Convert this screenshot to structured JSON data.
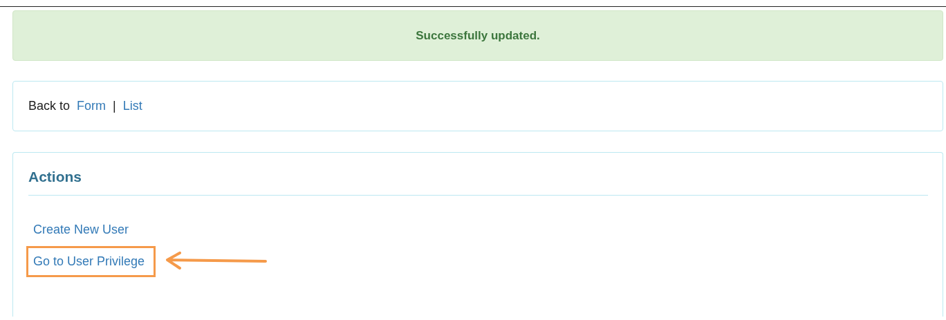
{
  "alert": {
    "message": "Successfully updated."
  },
  "back_nav": {
    "label": "Back to",
    "links": [
      "Form",
      "List"
    ],
    "separator": "|"
  },
  "actions": {
    "title": "Actions",
    "items": [
      {
        "label": "Create New User",
        "highlighted": false
      },
      {
        "label": "Go to User Privilege",
        "highlighted": true
      }
    ]
  }
}
